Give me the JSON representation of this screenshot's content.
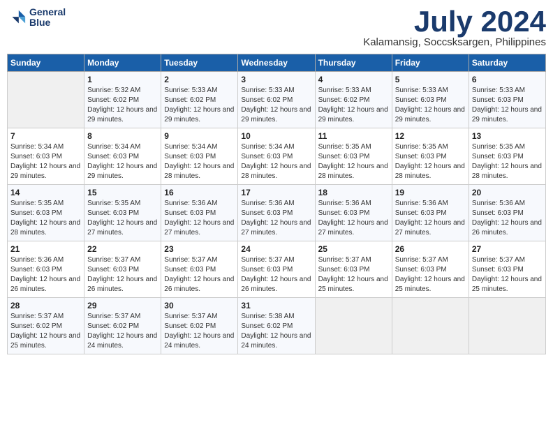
{
  "logo": {
    "line1": "General",
    "line2": "Blue"
  },
  "title": "July 2024",
  "location": "Kalamansig, Soccsksargen, Philippines",
  "columns": [
    "Sunday",
    "Monday",
    "Tuesday",
    "Wednesday",
    "Thursday",
    "Friday",
    "Saturday"
  ],
  "weeks": [
    [
      {
        "day": "",
        "sunrise": "",
        "sunset": "",
        "daylight": ""
      },
      {
        "day": "1",
        "sunrise": "Sunrise: 5:32 AM",
        "sunset": "Sunset: 6:02 PM",
        "daylight": "Daylight: 12 hours and 29 minutes."
      },
      {
        "day": "2",
        "sunrise": "Sunrise: 5:33 AM",
        "sunset": "Sunset: 6:02 PM",
        "daylight": "Daylight: 12 hours and 29 minutes."
      },
      {
        "day": "3",
        "sunrise": "Sunrise: 5:33 AM",
        "sunset": "Sunset: 6:02 PM",
        "daylight": "Daylight: 12 hours and 29 minutes."
      },
      {
        "day": "4",
        "sunrise": "Sunrise: 5:33 AM",
        "sunset": "Sunset: 6:02 PM",
        "daylight": "Daylight: 12 hours and 29 minutes."
      },
      {
        "day": "5",
        "sunrise": "Sunrise: 5:33 AM",
        "sunset": "Sunset: 6:03 PM",
        "daylight": "Daylight: 12 hours and 29 minutes."
      },
      {
        "day": "6",
        "sunrise": "Sunrise: 5:33 AM",
        "sunset": "Sunset: 6:03 PM",
        "daylight": "Daylight: 12 hours and 29 minutes."
      }
    ],
    [
      {
        "day": "7",
        "sunrise": "Sunrise: 5:34 AM",
        "sunset": "Sunset: 6:03 PM",
        "daylight": "Daylight: 12 hours and 29 minutes."
      },
      {
        "day": "8",
        "sunrise": "Sunrise: 5:34 AM",
        "sunset": "Sunset: 6:03 PM",
        "daylight": "Daylight: 12 hours and 29 minutes."
      },
      {
        "day": "9",
        "sunrise": "Sunrise: 5:34 AM",
        "sunset": "Sunset: 6:03 PM",
        "daylight": "Daylight: 12 hours and 28 minutes."
      },
      {
        "day": "10",
        "sunrise": "Sunrise: 5:34 AM",
        "sunset": "Sunset: 6:03 PM",
        "daylight": "Daylight: 12 hours and 28 minutes."
      },
      {
        "day": "11",
        "sunrise": "Sunrise: 5:35 AM",
        "sunset": "Sunset: 6:03 PM",
        "daylight": "Daylight: 12 hours and 28 minutes."
      },
      {
        "day": "12",
        "sunrise": "Sunrise: 5:35 AM",
        "sunset": "Sunset: 6:03 PM",
        "daylight": "Daylight: 12 hours and 28 minutes."
      },
      {
        "day": "13",
        "sunrise": "Sunrise: 5:35 AM",
        "sunset": "Sunset: 6:03 PM",
        "daylight": "Daylight: 12 hours and 28 minutes."
      }
    ],
    [
      {
        "day": "14",
        "sunrise": "Sunrise: 5:35 AM",
        "sunset": "Sunset: 6:03 PM",
        "daylight": "Daylight: 12 hours and 28 minutes."
      },
      {
        "day": "15",
        "sunrise": "Sunrise: 5:35 AM",
        "sunset": "Sunset: 6:03 PM",
        "daylight": "Daylight: 12 hours and 27 minutes."
      },
      {
        "day": "16",
        "sunrise": "Sunrise: 5:36 AM",
        "sunset": "Sunset: 6:03 PM",
        "daylight": "Daylight: 12 hours and 27 minutes."
      },
      {
        "day": "17",
        "sunrise": "Sunrise: 5:36 AM",
        "sunset": "Sunset: 6:03 PM",
        "daylight": "Daylight: 12 hours and 27 minutes."
      },
      {
        "day": "18",
        "sunrise": "Sunrise: 5:36 AM",
        "sunset": "Sunset: 6:03 PM",
        "daylight": "Daylight: 12 hours and 27 minutes."
      },
      {
        "day": "19",
        "sunrise": "Sunrise: 5:36 AM",
        "sunset": "Sunset: 6:03 PM",
        "daylight": "Daylight: 12 hours and 27 minutes."
      },
      {
        "day": "20",
        "sunrise": "Sunrise: 5:36 AM",
        "sunset": "Sunset: 6:03 PM",
        "daylight": "Daylight: 12 hours and 26 minutes."
      }
    ],
    [
      {
        "day": "21",
        "sunrise": "Sunrise: 5:36 AM",
        "sunset": "Sunset: 6:03 PM",
        "daylight": "Daylight: 12 hours and 26 minutes."
      },
      {
        "day": "22",
        "sunrise": "Sunrise: 5:37 AM",
        "sunset": "Sunset: 6:03 PM",
        "daylight": "Daylight: 12 hours and 26 minutes."
      },
      {
        "day": "23",
        "sunrise": "Sunrise: 5:37 AM",
        "sunset": "Sunset: 6:03 PM",
        "daylight": "Daylight: 12 hours and 26 minutes."
      },
      {
        "day": "24",
        "sunrise": "Sunrise: 5:37 AM",
        "sunset": "Sunset: 6:03 PM",
        "daylight": "Daylight: 12 hours and 26 minutes."
      },
      {
        "day": "25",
        "sunrise": "Sunrise: 5:37 AM",
        "sunset": "Sunset: 6:03 PM",
        "daylight": "Daylight: 12 hours and 25 minutes."
      },
      {
        "day": "26",
        "sunrise": "Sunrise: 5:37 AM",
        "sunset": "Sunset: 6:03 PM",
        "daylight": "Daylight: 12 hours and 25 minutes."
      },
      {
        "day": "27",
        "sunrise": "Sunrise: 5:37 AM",
        "sunset": "Sunset: 6:03 PM",
        "daylight": "Daylight: 12 hours and 25 minutes."
      }
    ],
    [
      {
        "day": "28",
        "sunrise": "Sunrise: 5:37 AM",
        "sunset": "Sunset: 6:02 PM",
        "daylight": "Daylight: 12 hours and 25 minutes."
      },
      {
        "day": "29",
        "sunrise": "Sunrise: 5:37 AM",
        "sunset": "Sunset: 6:02 PM",
        "daylight": "Daylight: 12 hours and 24 minutes."
      },
      {
        "day": "30",
        "sunrise": "Sunrise: 5:37 AM",
        "sunset": "Sunset: 6:02 PM",
        "daylight": "Daylight: 12 hours and 24 minutes."
      },
      {
        "day": "31",
        "sunrise": "Sunrise: 5:38 AM",
        "sunset": "Sunset: 6:02 PM",
        "daylight": "Daylight: 12 hours and 24 minutes."
      },
      {
        "day": "",
        "sunrise": "",
        "sunset": "",
        "daylight": ""
      },
      {
        "day": "",
        "sunrise": "",
        "sunset": "",
        "daylight": ""
      },
      {
        "day": "",
        "sunrise": "",
        "sunset": "",
        "daylight": ""
      }
    ]
  ]
}
